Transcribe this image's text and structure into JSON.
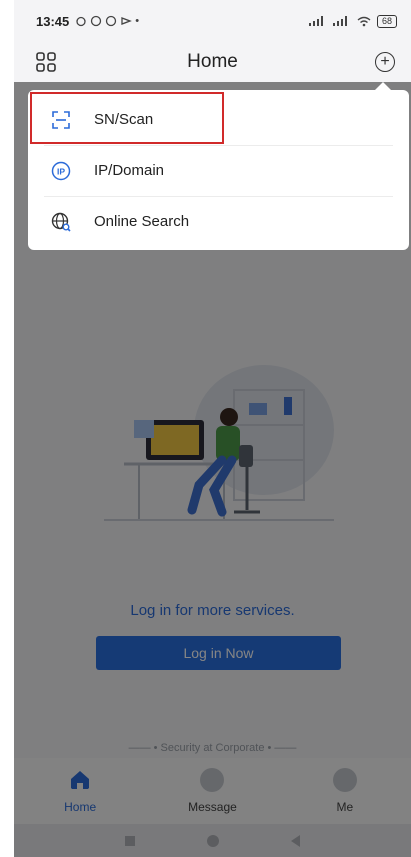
{
  "status_bar": {
    "time": "13:45",
    "battery": "68"
  },
  "header": {
    "title": "Home"
  },
  "main": {
    "login_prompt": "Log in for more services.",
    "login_button": "Log in Now",
    "slogan": "—— • Security at Corporate • ——"
  },
  "bottom_nav": {
    "items": [
      {
        "label": "Home",
        "icon": "home-icon",
        "active": true
      },
      {
        "label": "Message",
        "icon": "message-icon",
        "active": false
      },
      {
        "label": "Me",
        "icon": "user-icon",
        "active": false
      }
    ]
  },
  "popup_menu": {
    "items": [
      {
        "label": "SN/Scan",
        "icon": "scan-icon"
      },
      {
        "label": "IP/Domain",
        "icon": "ip-icon"
      },
      {
        "label": "Online Search",
        "icon": "globe-search-icon"
      }
    ],
    "highlighted_index": 0
  },
  "colors": {
    "accent": "#2a6fe0",
    "highlight_border": "#d12a2a"
  }
}
